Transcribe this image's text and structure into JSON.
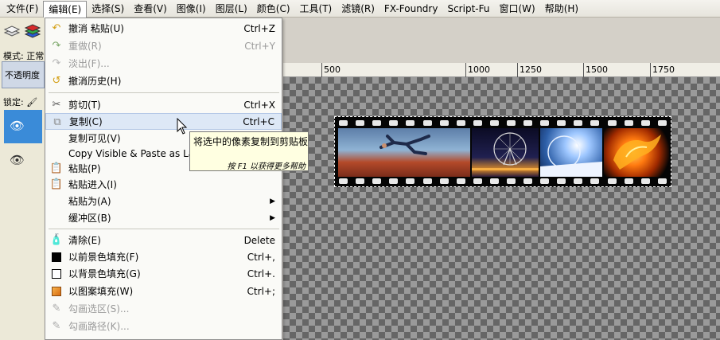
{
  "menubar": {
    "items": [
      "文件(F)",
      "编辑(E)",
      "选择(S)",
      "查看(V)",
      "图像(I)",
      "图层(L)",
      "颜色(C)",
      "工具(T)",
      "滤镜(R)",
      "FX-Foundry",
      "Script-Fu",
      "窗口(W)",
      "帮助(H)"
    ]
  },
  "left_panel": {
    "mode_label": "模式: 正常",
    "opacity_label": "不透明度",
    "lock_label": "锁定:"
  },
  "ruler": {
    "labels": [
      "500",
      "1000",
      "1250",
      "1500",
      "1750"
    ]
  },
  "edit_menu": {
    "items": [
      {
        "label": "撤消 粘贴(U)",
        "shortcut": "Ctrl+Z",
        "icon": "undo-icon",
        "disabled": false
      },
      {
        "label": "重做(R)",
        "shortcut": "Ctrl+Y",
        "icon": "redo-icon",
        "disabled": true
      },
      {
        "label": "淡出(F)...",
        "shortcut": "",
        "icon": "fade-icon",
        "disabled": true
      },
      {
        "label": "撤消历史(H)",
        "shortcut": "",
        "icon": "undo-history-icon",
        "disabled": false
      },
      {
        "label": "剪切(T)",
        "shortcut": "Ctrl+X",
        "icon": "scissors-icon",
        "disabled": false
      },
      {
        "label": "复制(C)",
        "shortcut": "Ctrl+C",
        "icon": "copy-icon",
        "disabled": false
      },
      {
        "label": "复制可见(V)",
        "shortcut": "",
        "icon": "",
        "disabled": false
      },
      {
        "label": "Copy Visible & Paste as Laye",
        "shortcut": "",
        "icon": "",
        "disabled": false
      },
      {
        "label": "粘贴(P)",
        "shortcut": "",
        "icon": "paste-icon",
        "disabled": false
      },
      {
        "label": "粘贴进入(I)",
        "shortcut": "",
        "icon": "paste-into-icon",
        "disabled": false
      },
      {
        "label": "粘贴为(A)",
        "shortcut": "",
        "icon": "",
        "disabled": false
      },
      {
        "label": "缓冲区(B)",
        "shortcut": "",
        "icon": "",
        "disabled": false
      },
      {
        "label": "清除(E)",
        "shortcut": "Delete",
        "icon": "clear-icon",
        "disabled": false
      },
      {
        "label": "以前景色填充(F)",
        "shortcut": "Ctrl+,",
        "icon": "fg-fill-icon",
        "disabled": false
      },
      {
        "label": "以背景色填充(G)",
        "shortcut": "Ctrl+.",
        "icon": "bg-fill-icon",
        "disabled": false
      },
      {
        "label": "以图案填充(W)",
        "shortcut": "Ctrl+;",
        "icon": "pattern-fill-icon",
        "disabled": false
      },
      {
        "label": "勾画选区(S)...",
        "shortcut": "",
        "icon": "stroke-selection-icon",
        "disabled": true
      },
      {
        "label": "勾画路径(K)...",
        "shortcut": "",
        "icon": "stroke-path-icon",
        "disabled": true
      }
    ]
  },
  "tooltip": {
    "text": "将选中的像素复制到剪贴板",
    "hint": "按 F1 以获得更多帮助"
  }
}
